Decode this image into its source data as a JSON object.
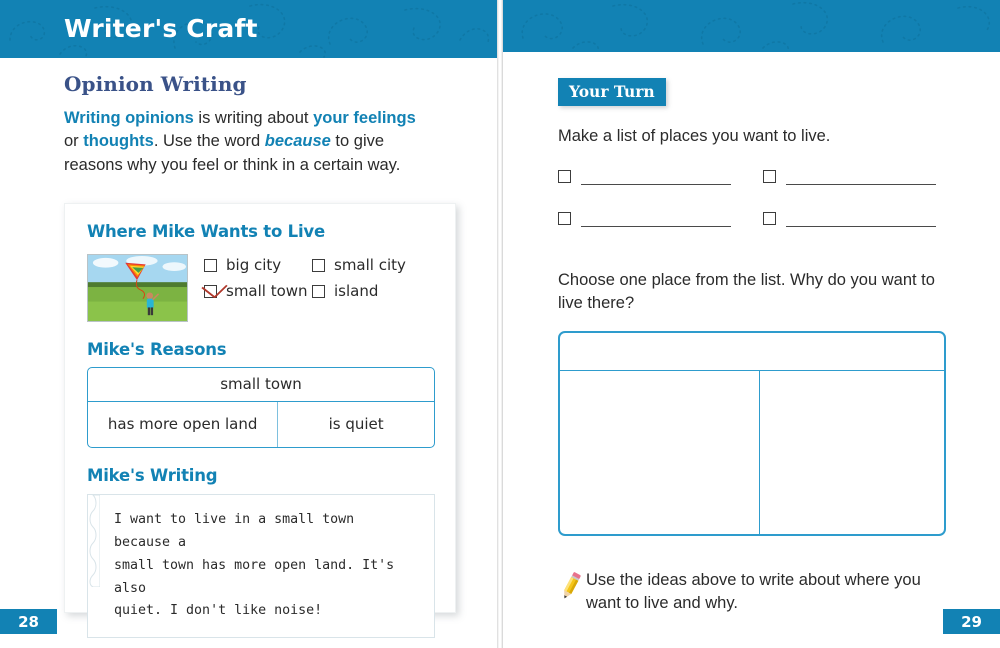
{
  "header": {
    "title": "Writer's Craft",
    "band_color": "#1282b4"
  },
  "left_page": {
    "heading": "Opinion Writing",
    "intro": {
      "part1_bold": "Writing opinions",
      "part2": " is writing about ",
      "part3_bold": "your feelings",
      "part4": " or ",
      "part5_bold": "thoughts",
      "part6": ". Use the word ",
      "part7_bold_italic": "because",
      "part8": " to give reasons why you feel or think in a certain way."
    },
    "example": {
      "heading": "Where Mike Wants to Live",
      "photo_alt": "child-flying-kite-in-field",
      "choices": [
        {
          "label": "big city",
          "checked": false
        },
        {
          "label": "small city",
          "checked": false
        },
        {
          "label": "small town",
          "checked": true
        },
        {
          "label": "island",
          "checked": false
        }
      ],
      "reasons_heading": "Mike's Reasons",
      "reasons_table": {
        "header": "small  town",
        "cells": [
          "has more open land",
          "is quiet"
        ]
      },
      "writing_heading": "Mike's Writing",
      "writing_lines": [
        "I want to live in a small town because a",
        "small town has more open land. It's also",
        "quiet. I don't like noise!"
      ]
    },
    "page_number": "28"
  },
  "right_page": {
    "badge": "Your Turn",
    "prompt1": "Make a list of places you want to live.",
    "list_lines": [
      {
        "value": "",
        "placeholder": ""
      },
      {
        "value": "",
        "placeholder": ""
      },
      {
        "value": "",
        "placeholder": ""
      },
      {
        "value": "",
        "placeholder": ""
      }
    ],
    "prompt2": "Choose one place from the list. Why do you want to live there?",
    "answer_table": {
      "header_value": "",
      "cell_left_value": "",
      "cell_right_value": ""
    },
    "final_note": "Use the ideas above to write about where you want to live and why.",
    "page_number": "29"
  },
  "colors": {
    "brand_blue": "#1282b4",
    "heading_navy": "#3a5288",
    "table_blue": "#2e9ccd",
    "check_red": "#b0392c"
  }
}
